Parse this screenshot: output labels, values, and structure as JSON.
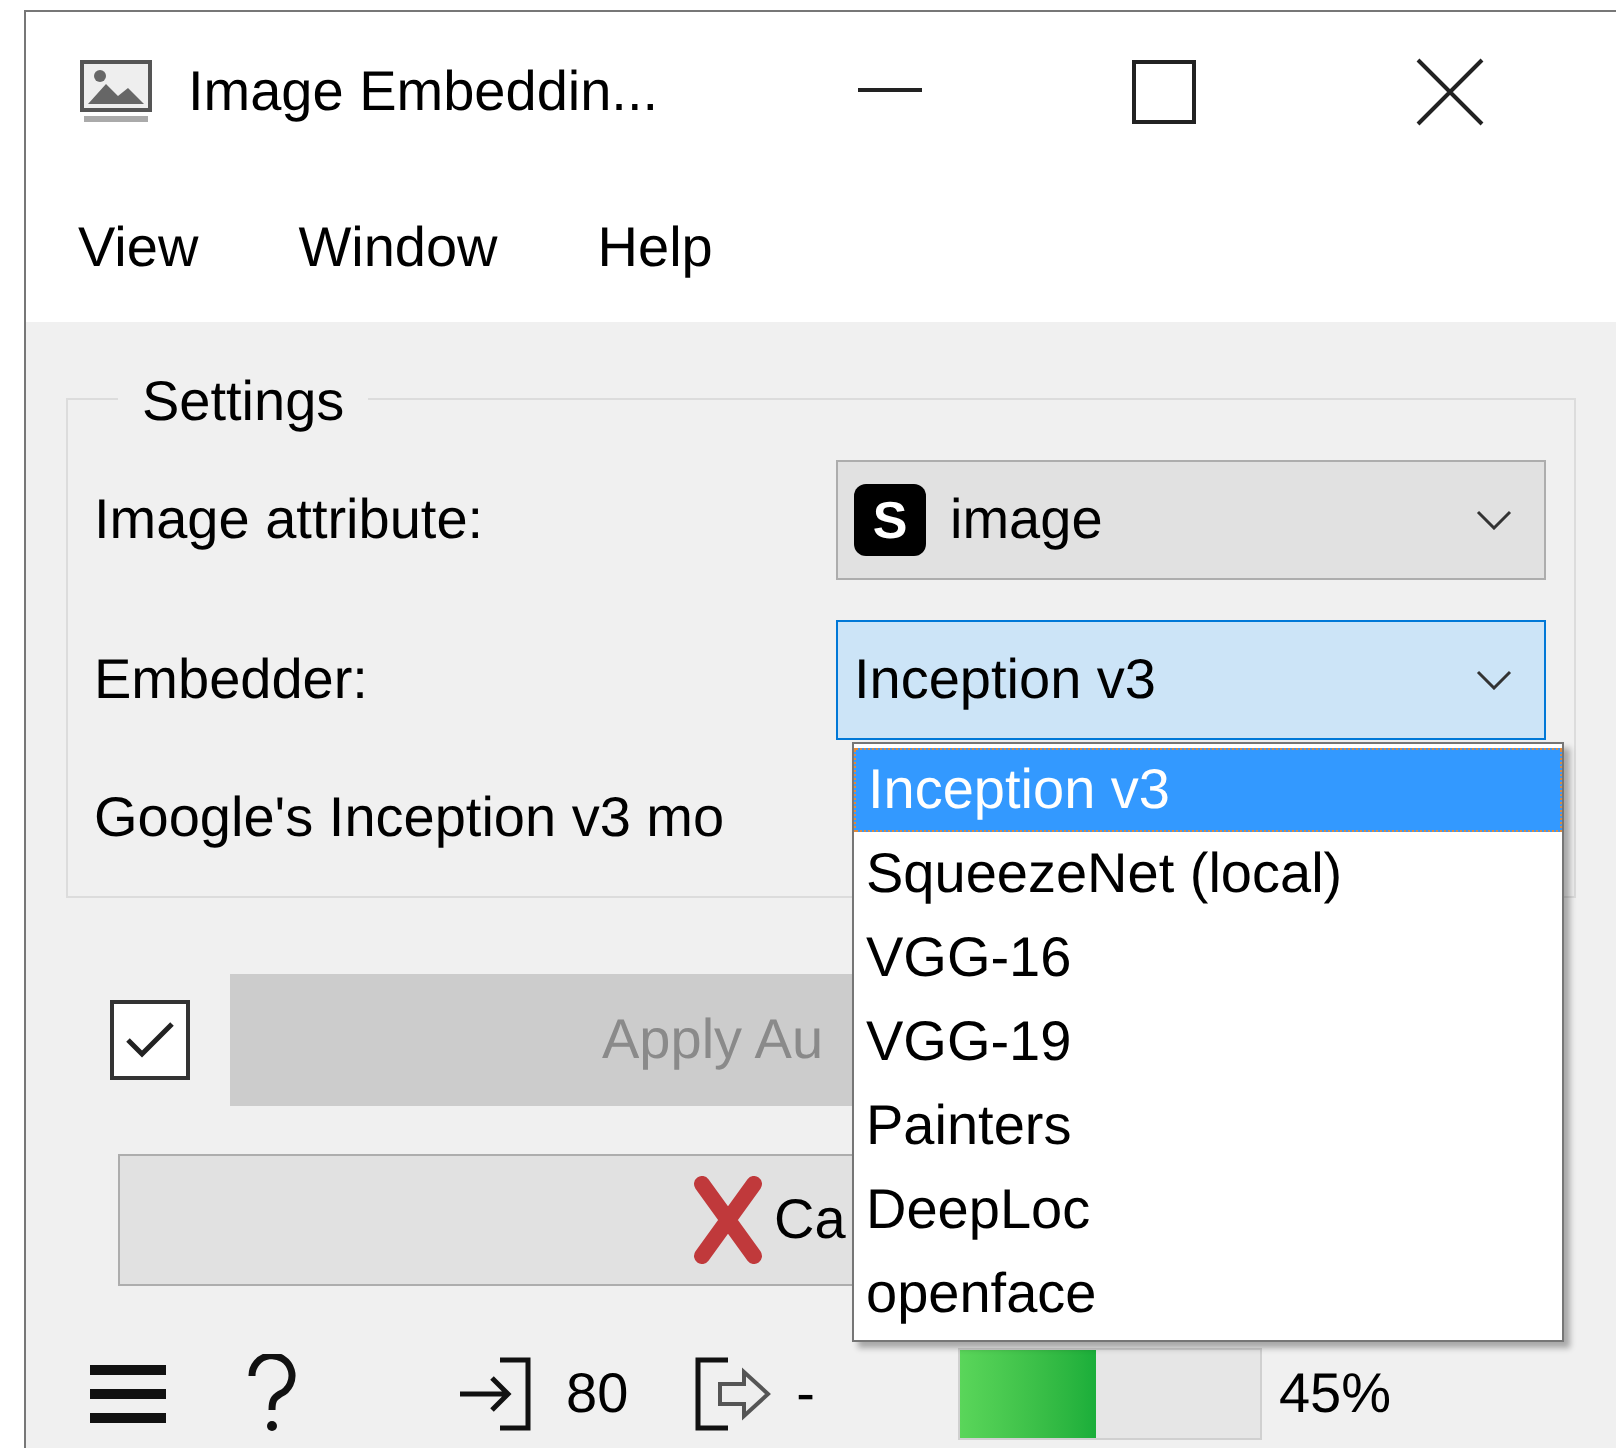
{
  "window": {
    "title": "Image Embeddin..."
  },
  "menu": [
    "View",
    "Window",
    "Help"
  ],
  "settings": {
    "title": "Settings",
    "rows": [
      {
        "label": "Image attribute:",
        "badge": "S",
        "value": "image",
        "focused": false
      },
      {
        "label": "Embedder:",
        "value": "Inception v3",
        "focused": true
      }
    ],
    "description": "Google's Inception v3 mo"
  },
  "dropdown": {
    "items": [
      {
        "label": "Inception v3",
        "selected": true
      },
      {
        "label": "SqueezeNet (local)",
        "selected": false
      },
      {
        "label": "VGG-16",
        "selected": false
      },
      {
        "label": "VGG-19",
        "selected": false
      },
      {
        "label": "Painters",
        "selected": false
      },
      {
        "label": "DeepLoc",
        "selected": false
      },
      {
        "label": "openface",
        "selected": false
      }
    ]
  },
  "auto_apply": {
    "checked": true,
    "label": "Apply Au",
    "disabled": true
  },
  "cancel": {
    "label": "Ca"
  },
  "status_bar": {
    "input_count": "80",
    "output_count": "-",
    "progress": {
      "level": 0.45,
      "reading": "45%"
    }
  }
}
